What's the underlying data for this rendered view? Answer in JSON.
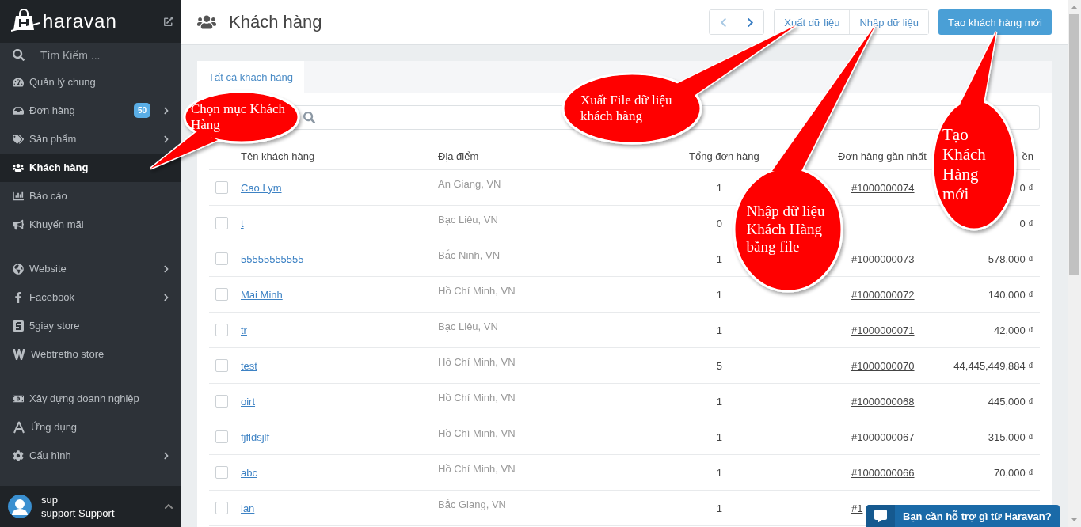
{
  "sidebar": {
    "brand": "haravan",
    "search": {
      "placeholder": "Tìm Kiếm ..."
    },
    "groups": [
      [
        {
          "label": "Quản lý chung",
          "selected": false,
          "has_submenu": false
        },
        {
          "label": "Đơn hàng",
          "selected": false,
          "has_submenu": true,
          "badge": "50"
        },
        {
          "label": "Sản phẩm",
          "selected": false,
          "has_submenu": true
        },
        {
          "label": "Khách hàng",
          "selected": true,
          "has_submenu": false
        },
        {
          "label": "Báo cáo",
          "selected": false,
          "has_submenu": false
        },
        {
          "label": "Khuyến mãi",
          "selected": false,
          "has_submenu": false
        }
      ],
      [
        {
          "label": "Website",
          "selected": false,
          "has_submenu": true
        },
        {
          "label": "Facebook",
          "selected": false,
          "has_submenu": true
        },
        {
          "label": "5giay store",
          "selected": false,
          "has_submenu": false
        },
        {
          "label": "Webtretho store",
          "selected": false,
          "has_submenu": false
        }
      ],
      [
        {
          "label": "Xây dựng doanh nghiệp",
          "selected": false,
          "has_submenu": false
        },
        {
          "label": "Ứng dụng",
          "selected": false,
          "has_submenu": false
        },
        {
          "label": "Cấu hình",
          "selected": false,
          "has_submenu": true
        }
      ]
    ],
    "user": {
      "name": "sup",
      "role": "support Support"
    }
  },
  "page": {
    "title": "Khách hàng",
    "pager": [
      {
        "disabled": true
      },
      {
        "disabled": false
      }
    ],
    "actions": [
      {
        "label": "Xuất dữ liệu",
        "primary": false
      },
      {
        "label": "Nhập dữ liệu",
        "primary": false
      },
      {
        "label": "Tạo khách hàng mới",
        "primary": true
      }
    ]
  },
  "tabs": [
    {
      "label": "Tất cả khách hàng",
      "selected": true
    }
  ],
  "table": {
    "columns": [
      "Tên khách hàng",
      "Địa điểm",
      "Tổng đơn hàng",
      "Đơn hàng gần nhất",
      "ền"
    ],
    "rows": [
      {
        "name": "Cao Lym",
        "location": "An Giang, VN",
        "orders": "1",
        "last_order": "#1000000074",
        "amount": "0 ₫",
        "checked": false
      },
      {
        "name": "t",
        "location": "Bạc Liêu, VN",
        "orders": "0",
        "amount": "0 ₫",
        "checked": false
      },
      {
        "name": "55555555555",
        "location": "Bắc Ninh, VN",
        "orders": "1",
        "last_order": "#1000000073",
        "amount": "578,000 ₫",
        "checked": false
      },
      {
        "name": "Mai Minh",
        "location": "Hồ Chí Minh, VN",
        "orders": "1",
        "last_order": "#1000000072",
        "amount": "140,000 ₫",
        "checked": false
      },
      {
        "name": "tr",
        "location": "Bạc Liêu, VN",
        "orders": "1",
        "last_order": "#1000000071",
        "amount": "42,000 ₫",
        "checked": false
      },
      {
        "name": "test",
        "location": "Hồ Chí Minh, VN",
        "orders": "5",
        "last_order": "#1000000070",
        "amount": "44,445,449,884 ₫",
        "checked": false
      },
      {
        "name": "oirt",
        "location": "Hồ Chí Minh, VN",
        "orders": "1",
        "last_order": "#1000000068",
        "amount": "445,000 ₫",
        "checked": false
      },
      {
        "name": "fjfldsjlf",
        "location": "Hồ Chí Minh, VN",
        "orders": "1",
        "last_order": "#1000000067",
        "amount": "315,000 ₫",
        "checked": false
      },
      {
        "name": "abc",
        "location": "Hồ Chí Minh, VN",
        "orders": "1",
        "last_order": "#1000000066",
        "amount": "70,000 ₫",
        "checked": false
      },
      {
        "name": "lan",
        "location": "Bắc Giang, VN",
        "orders": "1",
        "last_order": "#1",
        "checked": false
      }
    ]
  },
  "callouts": [
    {
      "text": "Chọn mục Khách Hàng"
    },
    {
      "text": "Xuất File dữ liệu khách hàng"
    },
    {
      "text": "Nhập dữ liệu Khách Hàng bằng file"
    },
    {
      "text": "Tạo Khách Hàng mới"
    }
  ],
  "chat": {
    "text": "Bạn cần hỗ trợ gì từ Haravan?"
  }
}
